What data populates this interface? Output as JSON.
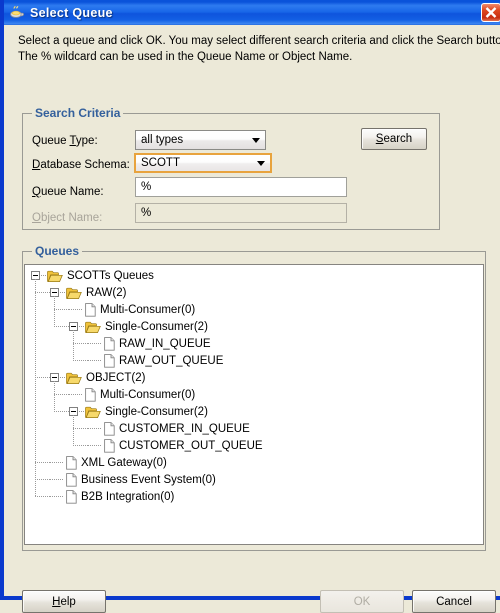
{
  "window": {
    "title": "Select Queue",
    "icon": "coffee-cup-icon",
    "close_label": "✕",
    "titlebar_color": "#1866e8",
    "close_color": "#c72e11"
  },
  "instructions": {
    "line1": "Select a queue and click OK. You may select different search criteria and click the Search button.",
    "line2": "The % wildcard can be used in the Queue Name or Object Name."
  },
  "search_criteria": {
    "group_title": "Search Criteria",
    "queue_type": {
      "label_pre": "Queue ",
      "label_mnemonic": "T",
      "label_post": "ype:",
      "value": "all types",
      "options": [
        "all types"
      ]
    },
    "database_schema": {
      "label_pre": "",
      "label_mnemonic": "D",
      "label_post": "atabase Schema:",
      "value": "SCOTT",
      "options": [
        "SCOTT"
      ],
      "focus_color": "#e8a33d"
    },
    "queue_name": {
      "label_pre": "",
      "label_mnemonic": "Q",
      "label_post": "ueue Name:",
      "value": "%",
      "placeholder": ""
    },
    "object_name": {
      "label_pre": "",
      "label_mnemonic": "O",
      "label_post": "bject Name:",
      "value": "%",
      "placeholder": "",
      "disabled": true
    },
    "search_button": {
      "label_pre": "",
      "label_mnemonic": "S",
      "label_post": "earch"
    }
  },
  "queues": {
    "group_title": "Queues",
    "tree": [
      {
        "label": "SCOTTs Queues",
        "depth": 0,
        "icon": "folder-open-icon",
        "expanded": true
      },
      {
        "label": "RAW(2)",
        "depth": 1,
        "icon": "folder-open-icon",
        "expanded": true
      },
      {
        "label": "Multi-Consumer(0)",
        "depth": 2,
        "icon": "document-icon",
        "expanded": null
      },
      {
        "label": "Single-Consumer(2)",
        "depth": 2,
        "icon": "folder-open-icon",
        "expanded": true
      },
      {
        "label": "RAW_IN_QUEUE",
        "depth": 3,
        "icon": "document-icon",
        "expanded": null
      },
      {
        "label": "RAW_OUT_QUEUE",
        "depth": 3,
        "icon": "document-icon",
        "expanded": null
      },
      {
        "label": "OBJECT(2)",
        "depth": 1,
        "icon": "folder-open-icon",
        "expanded": true
      },
      {
        "label": "Multi-Consumer(0)",
        "depth": 2,
        "icon": "document-icon",
        "expanded": null
      },
      {
        "label": "Single-Consumer(2)",
        "depth": 2,
        "icon": "folder-open-icon",
        "expanded": true
      },
      {
        "label": "CUSTOMER_IN_QUEUE",
        "depth": 3,
        "icon": "document-icon",
        "expanded": null
      },
      {
        "label": "CUSTOMER_OUT_QUEUE",
        "depth": 3,
        "icon": "document-icon",
        "expanded": null
      },
      {
        "label": "XML Gateway(0)",
        "depth": 1,
        "icon": "document-icon",
        "expanded": null
      },
      {
        "label": "Business Event System(0)",
        "depth": 1,
        "icon": "document-icon",
        "expanded": null
      },
      {
        "label": "B2B Integration(0)",
        "depth": 1,
        "icon": "document-icon",
        "expanded": null
      }
    ]
  },
  "footer": {
    "help": {
      "label_pre": "",
      "label_mnemonic": "H",
      "label_post": "elp"
    },
    "ok": {
      "label": "OK",
      "disabled": true
    },
    "cancel": {
      "label": "Cancel"
    }
  }
}
